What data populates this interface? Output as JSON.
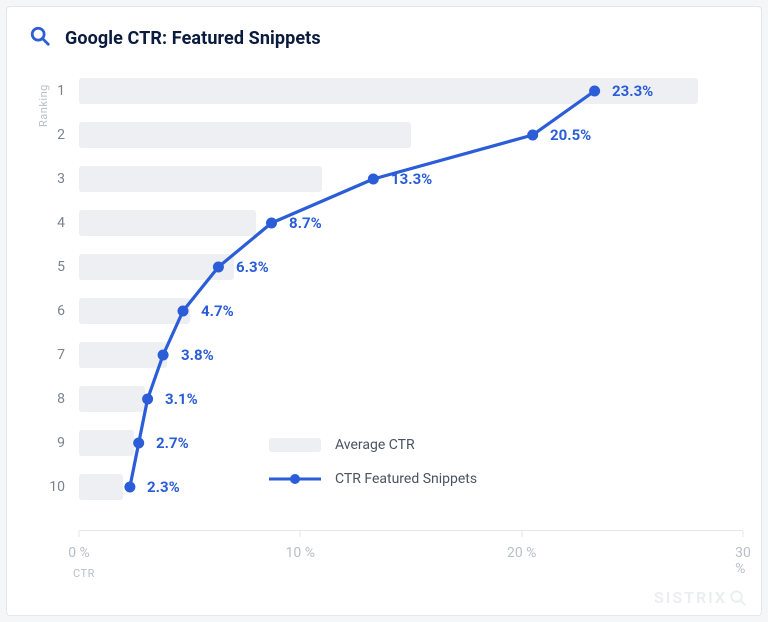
{
  "header": {
    "title": "Google CTR: Featured Snippets"
  },
  "axes": {
    "ylabel": "Ranking",
    "xlabel": "CTR",
    "xticks": [
      "0 %",
      "10 %",
      "20 %",
      "30 %"
    ],
    "yticks": [
      "1",
      "2",
      "3",
      "4",
      "5",
      "6",
      "7",
      "8",
      "9",
      "10"
    ]
  },
  "legend": {
    "bar": "Average CTR",
    "line": "CTR Featured Snippets"
  },
  "labels": {
    "r1": "23.3%",
    "r2": "20.5%",
    "r3": "13.3%",
    "r4": "8.7%",
    "r5": "6.3%",
    "r6": "4.7%",
    "r7": "3.8%",
    "r8": "3.1%",
    "r9": "2.7%",
    "r10": "2.3%"
  },
  "watermark": "SISTRIX",
  "chart_data": {
    "type": "bar",
    "title": "Google CTR: Featured Snippets",
    "xlabel": "CTR",
    "ylabel": "Ranking",
    "xlim": [
      0,
      30
    ],
    "categories": [
      1,
      2,
      3,
      4,
      5,
      6,
      7,
      8,
      9,
      10
    ],
    "series": [
      {
        "name": "Average CTR",
        "type": "bar",
        "values": [
          28.0,
          15.0,
          11.0,
          8.0,
          7.0,
          5.0,
          4.0,
          3.0,
          2.5,
          2.0
        ]
      },
      {
        "name": "CTR Featured Snippets",
        "type": "line",
        "values": [
          23.3,
          20.5,
          13.3,
          8.7,
          6.3,
          4.7,
          3.8,
          3.1,
          2.7,
          2.3
        ]
      }
    ],
    "legend_position": "inside-right",
    "grid": false
  }
}
